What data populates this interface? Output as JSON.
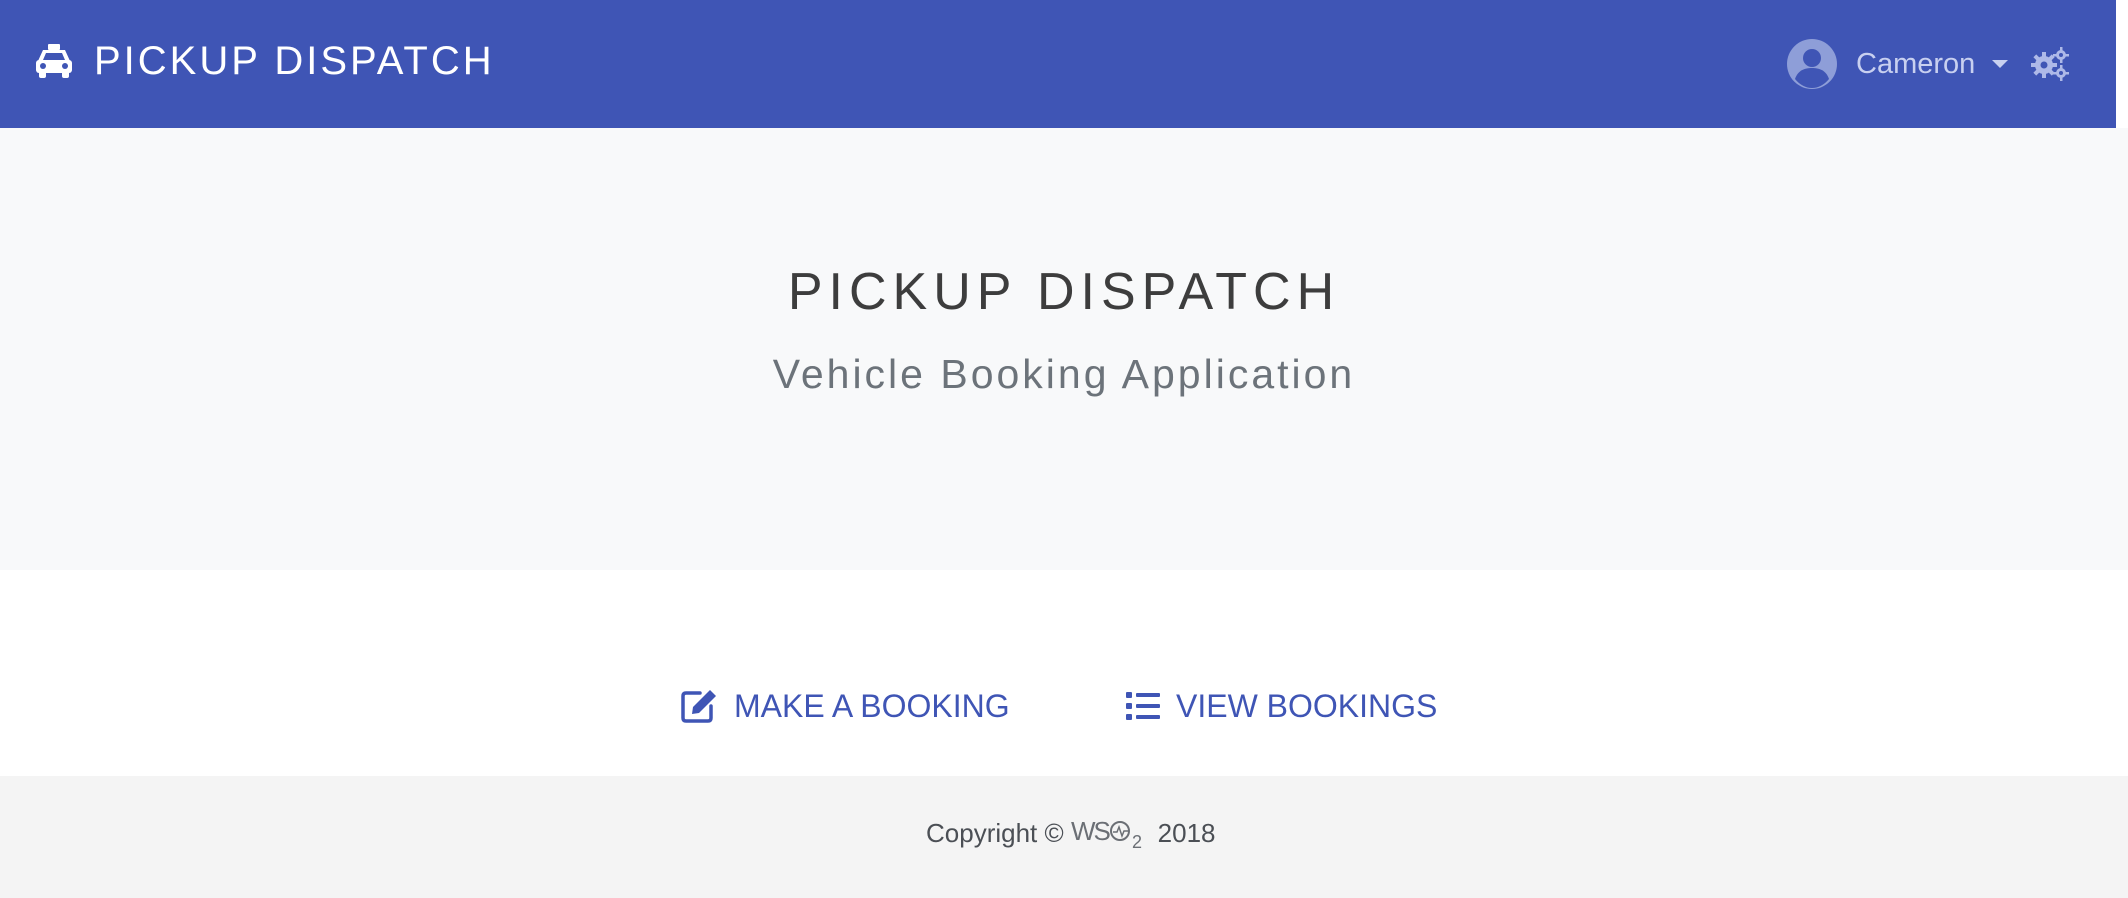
{
  "navbar": {
    "brand_text": "PICKUP DISPATCH",
    "brand_icon": "taxi-car-icon",
    "user_name": "Cameron",
    "user_icon": "user-circle-icon",
    "dropdown_icon": "caret-down-icon",
    "settings_icon": "gears-icon",
    "background": "#3f55b5"
  },
  "hero": {
    "title": "PICKUP DISPATCH",
    "subtitle": "Vehicle Booking Application"
  },
  "actions": {
    "make_booking": {
      "label": "MAKE A BOOKING",
      "icon": "edit-icon"
    },
    "view_bookings": {
      "label": "VIEW BOOKINGS",
      "icon": "list-icon"
    },
    "link_color": "#3f55b5"
  },
  "footer": {
    "copyright_prefix": "Copyright ©",
    "logo": "WSO2",
    "year": "2018"
  }
}
